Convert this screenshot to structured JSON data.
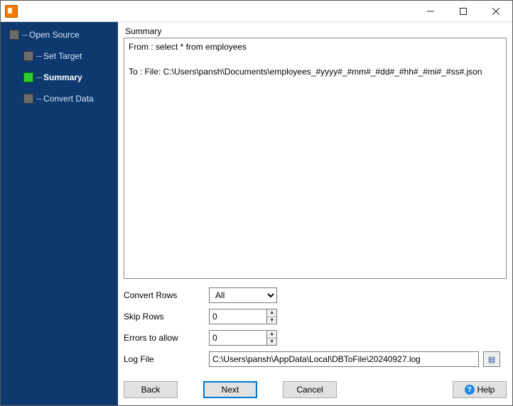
{
  "window": {
    "title": ""
  },
  "sidebar": {
    "items": [
      {
        "label": "Open Source",
        "current": false
      },
      {
        "label": "Set Target",
        "current": false
      },
      {
        "label": "Summary",
        "current": true
      },
      {
        "label": "Convert Data",
        "current": false
      }
    ]
  },
  "summary": {
    "heading": "Summary",
    "from_line": "From : select * from employees",
    "to_line": "To : File: C:\\Users\\pansh\\Documents\\employees_#yyyy#_#mm#_#dd#_#hh#_#mi#_#ss#.json"
  },
  "options": {
    "convert_rows": {
      "label": "Convert Rows",
      "value": "All"
    },
    "skip_rows": {
      "label": "Skip Rows",
      "value": "0"
    },
    "errors_allow": {
      "label": "Errors to allow",
      "value": "0"
    },
    "log_file": {
      "label": "Log File",
      "value": "C:\\Users\\pansh\\AppData\\Local\\DBToFile\\20240927.log"
    }
  },
  "footer": {
    "back": "Back",
    "next": "Next",
    "cancel": "Cancel",
    "help": "Help"
  }
}
